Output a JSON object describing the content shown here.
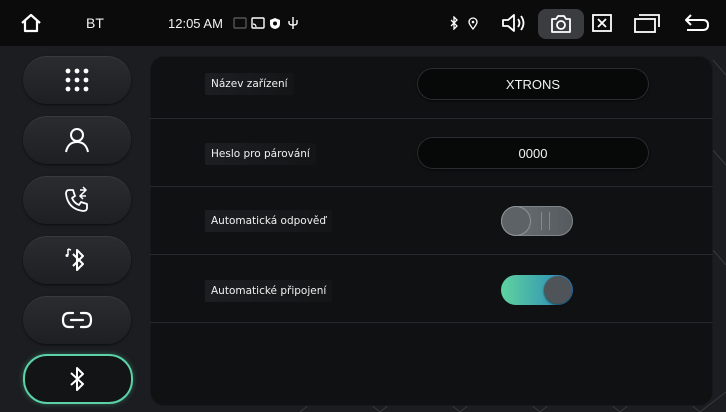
{
  "statusbar": {
    "section_label": "BT",
    "time": "12:05 AM"
  },
  "sidebar": {
    "items": [
      {
        "name": "apps",
        "icon": "grid-icon"
      },
      {
        "name": "contacts",
        "icon": "person-icon"
      },
      {
        "name": "call-log",
        "icon": "phone-icon"
      },
      {
        "name": "bt-music",
        "icon": "bluetooth-music-icon"
      },
      {
        "name": "link",
        "icon": "link-icon"
      },
      {
        "name": "bt-settings",
        "icon": "bluetooth-icon",
        "active": true
      }
    ]
  },
  "settings": {
    "device_name_label": "Název zařízení",
    "device_name_value": "XTRONS",
    "pairing_code_label": "Heslo pro párování",
    "pairing_code_value": "0000",
    "auto_answer_label": "Automatická odpověď",
    "auto_answer_on": false,
    "auto_connect_label": "Automatické připojení",
    "auto_connect_on": true
  },
  "colors": {
    "accent": "#5bd3a7",
    "toggle_on_start": "#5fd39f",
    "toggle_on_end": "#2d7cc2"
  }
}
